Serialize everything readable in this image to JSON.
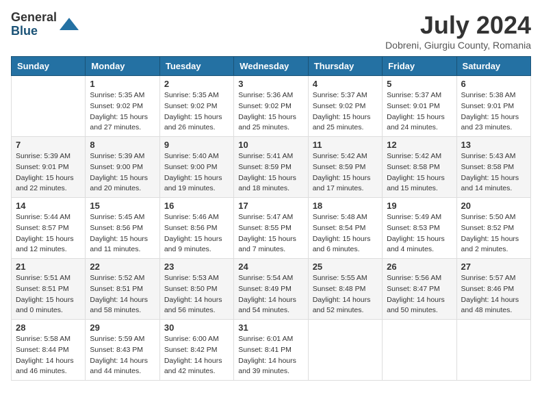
{
  "logo": {
    "general": "General",
    "blue": "Blue"
  },
  "title": "July 2024",
  "location": "Dobreni, Giurgiu County, Romania",
  "headers": [
    "Sunday",
    "Monday",
    "Tuesday",
    "Wednesday",
    "Thursday",
    "Friday",
    "Saturday"
  ],
  "weeks": [
    [
      {
        "day": "",
        "info": ""
      },
      {
        "day": "1",
        "info": "Sunrise: 5:35 AM\nSunset: 9:02 PM\nDaylight: 15 hours\nand 27 minutes."
      },
      {
        "day": "2",
        "info": "Sunrise: 5:35 AM\nSunset: 9:02 PM\nDaylight: 15 hours\nand 26 minutes."
      },
      {
        "day": "3",
        "info": "Sunrise: 5:36 AM\nSunset: 9:02 PM\nDaylight: 15 hours\nand 25 minutes."
      },
      {
        "day": "4",
        "info": "Sunrise: 5:37 AM\nSunset: 9:02 PM\nDaylight: 15 hours\nand 25 minutes."
      },
      {
        "day": "5",
        "info": "Sunrise: 5:37 AM\nSunset: 9:01 PM\nDaylight: 15 hours\nand 24 minutes."
      },
      {
        "day": "6",
        "info": "Sunrise: 5:38 AM\nSunset: 9:01 PM\nDaylight: 15 hours\nand 23 minutes."
      }
    ],
    [
      {
        "day": "7",
        "info": "Sunrise: 5:39 AM\nSunset: 9:01 PM\nDaylight: 15 hours\nand 22 minutes."
      },
      {
        "day": "8",
        "info": "Sunrise: 5:39 AM\nSunset: 9:00 PM\nDaylight: 15 hours\nand 20 minutes."
      },
      {
        "day": "9",
        "info": "Sunrise: 5:40 AM\nSunset: 9:00 PM\nDaylight: 15 hours\nand 19 minutes."
      },
      {
        "day": "10",
        "info": "Sunrise: 5:41 AM\nSunset: 8:59 PM\nDaylight: 15 hours\nand 18 minutes."
      },
      {
        "day": "11",
        "info": "Sunrise: 5:42 AM\nSunset: 8:59 PM\nDaylight: 15 hours\nand 17 minutes."
      },
      {
        "day": "12",
        "info": "Sunrise: 5:42 AM\nSunset: 8:58 PM\nDaylight: 15 hours\nand 15 minutes."
      },
      {
        "day": "13",
        "info": "Sunrise: 5:43 AM\nSunset: 8:58 PM\nDaylight: 15 hours\nand 14 minutes."
      }
    ],
    [
      {
        "day": "14",
        "info": "Sunrise: 5:44 AM\nSunset: 8:57 PM\nDaylight: 15 hours\nand 12 minutes."
      },
      {
        "day": "15",
        "info": "Sunrise: 5:45 AM\nSunset: 8:56 PM\nDaylight: 15 hours\nand 11 minutes."
      },
      {
        "day": "16",
        "info": "Sunrise: 5:46 AM\nSunset: 8:56 PM\nDaylight: 15 hours\nand 9 minutes."
      },
      {
        "day": "17",
        "info": "Sunrise: 5:47 AM\nSunset: 8:55 PM\nDaylight: 15 hours\nand 7 minutes."
      },
      {
        "day": "18",
        "info": "Sunrise: 5:48 AM\nSunset: 8:54 PM\nDaylight: 15 hours\nand 6 minutes."
      },
      {
        "day": "19",
        "info": "Sunrise: 5:49 AM\nSunset: 8:53 PM\nDaylight: 15 hours\nand 4 minutes."
      },
      {
        "day": "20",
        "info": "Sunrise: 5:50 AM\nSunset: 8:52 PM\nDaylight: 15 hours\nand 2 minutes."
      }
    ],
    [
      {
        "day": "21",
        "info": "Sunrise: 5:51 AM\nSunset: 8:51 PM\nDaylight: 15 hours\nand 0 minutes."
      },
      {
        "day": "22",
        "info": "Sunrise: 5:52 AM\nSunset: 8:51 PM\nDaylight: 14 hours\nand 58 minutes."
      },
      {
        "day": "23",
        "info": "Sunrise: 5:53 AM\nSunset: 8:50 PM\nDaylight: 14 hours\nand 56 minutes."
      },
      {
        "day": "24",
        "info": "Sunrise: 5:54 AM\nSunset: 8:49 PM\nDaylight: 14 hours\nand 54 minutes."
      },
      {
        "day": "25",
        "info": "Sunrise: 5:55 AM\nSunset: 8:48 PM\nDaylight: 14 hours\nand 52 minutes."
      },
      {
        "day": "26",
        "info": "Sunrise: 5:56 AM\nSunset: 8:47 PM\nDaylight: 14 hours\nand 50 minutes."
      },
      {
        "day": "27",
        "info": "Sunrise: 5:57 AM\nSunset: 8:46 PM\nDaylight: 14 hours\nand 48 minutes."
      }
    ],
    [
      {
        "day": "28",
        "info": "Sunrise: 5:58 AM\nSunset: 8:44 PM\nDaylight: 14 hours\nand 46 minutes."
      },
      {
        "day": "29",
        "info": "Sunrise: 5:59 AM\nSunset: 8:43 PM\nDaylight: 14 hours\nand 44 minutes."
      },
      {
        "day": "30",
        "info": "Sunrise: 6:00 AM\nSunset: 8:42 PM\nDaylight: 14 hours\nand 42 minutes."
      },
      {
        "day": "31",
        "info": "Sunrise: 6:01 AM\nSunset: 8:41 PM\nDaylight: 14 hours\nand 39 minutes."
      },
      {
        "day": "",
        "info": ""
      },
      {
        "day": "",
        "info": ""
      },
      {
        "day": "",
        "info": ""
      }
    ]
  ]
}
